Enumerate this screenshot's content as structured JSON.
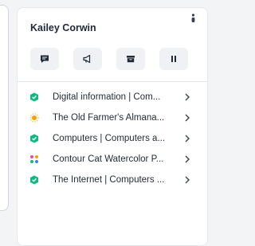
{
  "profile": {
    "name": "Kailey Corwin"
  },
  "actions": [
    {
      "icon": "chat-icon"
    },
    {
      "icon": "megaphone-icon"
    },
    {
      "icon": "archive-icon"
    },
    {
      "icon": "pause-icon"
    }
  ],
  "history": [
    {
      "label": "Digital information | Com...",
      "favicon": "green-badge-icon"
    },
    {
      "label": "The Old Farmer's Almana...",
      "favicon": "orange-sun-icon"
    },
    {
      "label": "Computers | Computers a...",
      "favicon": "green-badge-icon"
    },
    {
      "label": "Contour Cat Watercolor P...",
      "favicon": "colorful-dots-icon"
    },
    {
      "label": "The Internet | Computers ...",
      "favicon": "green-badge-icon"
    }
  ],
  "colors": {
    "accent": "#1f2937",
    "button_bg": "#f0f1f4",
    "favicon_green": "#10b981",
    "favicon_orange": "#f59e0b"
  }
}
